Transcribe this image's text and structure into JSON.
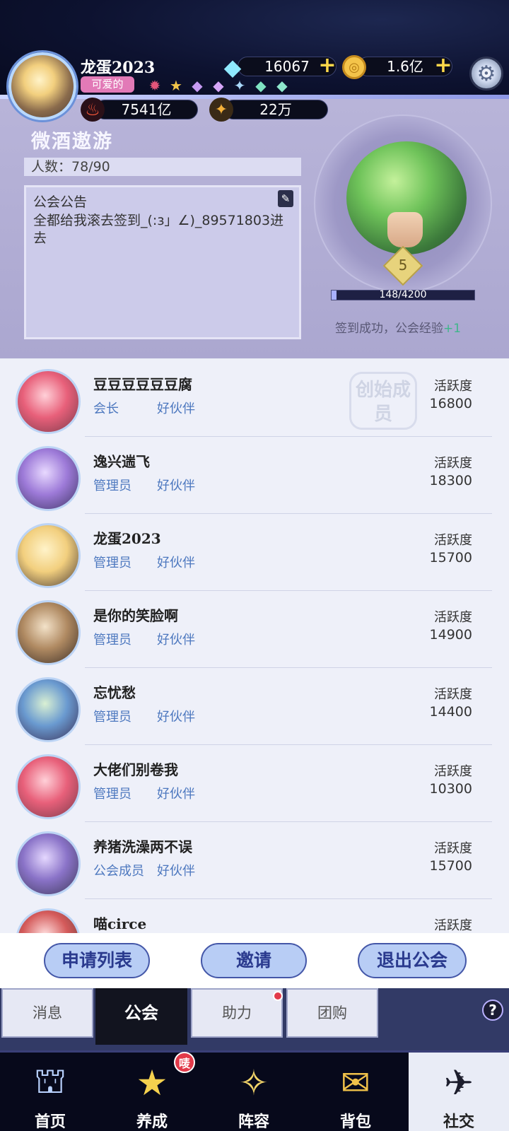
{
  "player": {
    "name": "龙蛋2023",
    "title_badge": "可爱的",
    "diamonds": "16067",
    "coins": "1.6亿",
    "power": "7541亿",
    "stars": "22万"
  },
  "guild": {
    "name": "微酒遨游",
    "member_count": "人数：78/90",
    "notice_title": "公会公告",
    "notice_text": "全都给我滚去签到_(:з」∠)_89571803进去",
    "level": "5",
    "exp_text": "148/4200",
    "exp_fraction": 0.035,
    "signin_text": "签到成功，公会经验",
    "signin_plus": "+1"
  },
  "list": {
    "activity_label": "活跃度",
    "founder_badge": "创始成员",
    "members": [
      {
        "name": "豆豆豆豆豆豆腐",
        "role": "会长",
        "relation": "好伙伴",
        "activity": "16800"
      },
      {
        "name": "逸兴遄飞",
        "role": "管理员",
        "relation": "好伙伴",
        "activity": "18300"
      },
      {
        "name": "龙蛋2023",
        "role": "管理员",
        "relation": "好伙伴",
        "activity": "15700"
      },
      {
        "name": "是你的笑脸啊",
        "role": "管理员",
        "relation": "好伙伴",
        "activity": "14900"
      },
      {
        "name": "忘忧愁",
        "role": "管理员",
        "relation": "好伙伴",
        "activity": "14400"
      },
      {
        "name": "大佬们别卷我",
        "role": "管理员",
        "relation": "好伙伴",
        "activity": "10300"
      },
      {
        "name": "养猪洗澡两不误",
        "role": "公会成员",
        "relation": "好伙伴",
        "activity": "15700"
      },
      {
        "name": "喵circe",
        "role": "",
        "relation": "",
        "activity": ""
      }
    ]
  },
  "actions": {
    "apply_list": "申请列表",
    "invite": "邀请",
    "quit": "退出公会"
  },
  "subtabs": [
    "消息",
    "公会",
    "助力",
    "团购"
  ],
  "nav": {
    "items": [
      "首页",
      "养成",
      "阵容",
      "背包",
      "社交"
    ],
    "badge": "唛"
  },
  "colors": {
    "accent": "#4d78bf",
    "button_fill": "#b8cdf5",
    "button_text": "#2a3a8e",
    "guild_panel": "#aba7d0",
    "nav_bg": "#07091b"
  }
}
